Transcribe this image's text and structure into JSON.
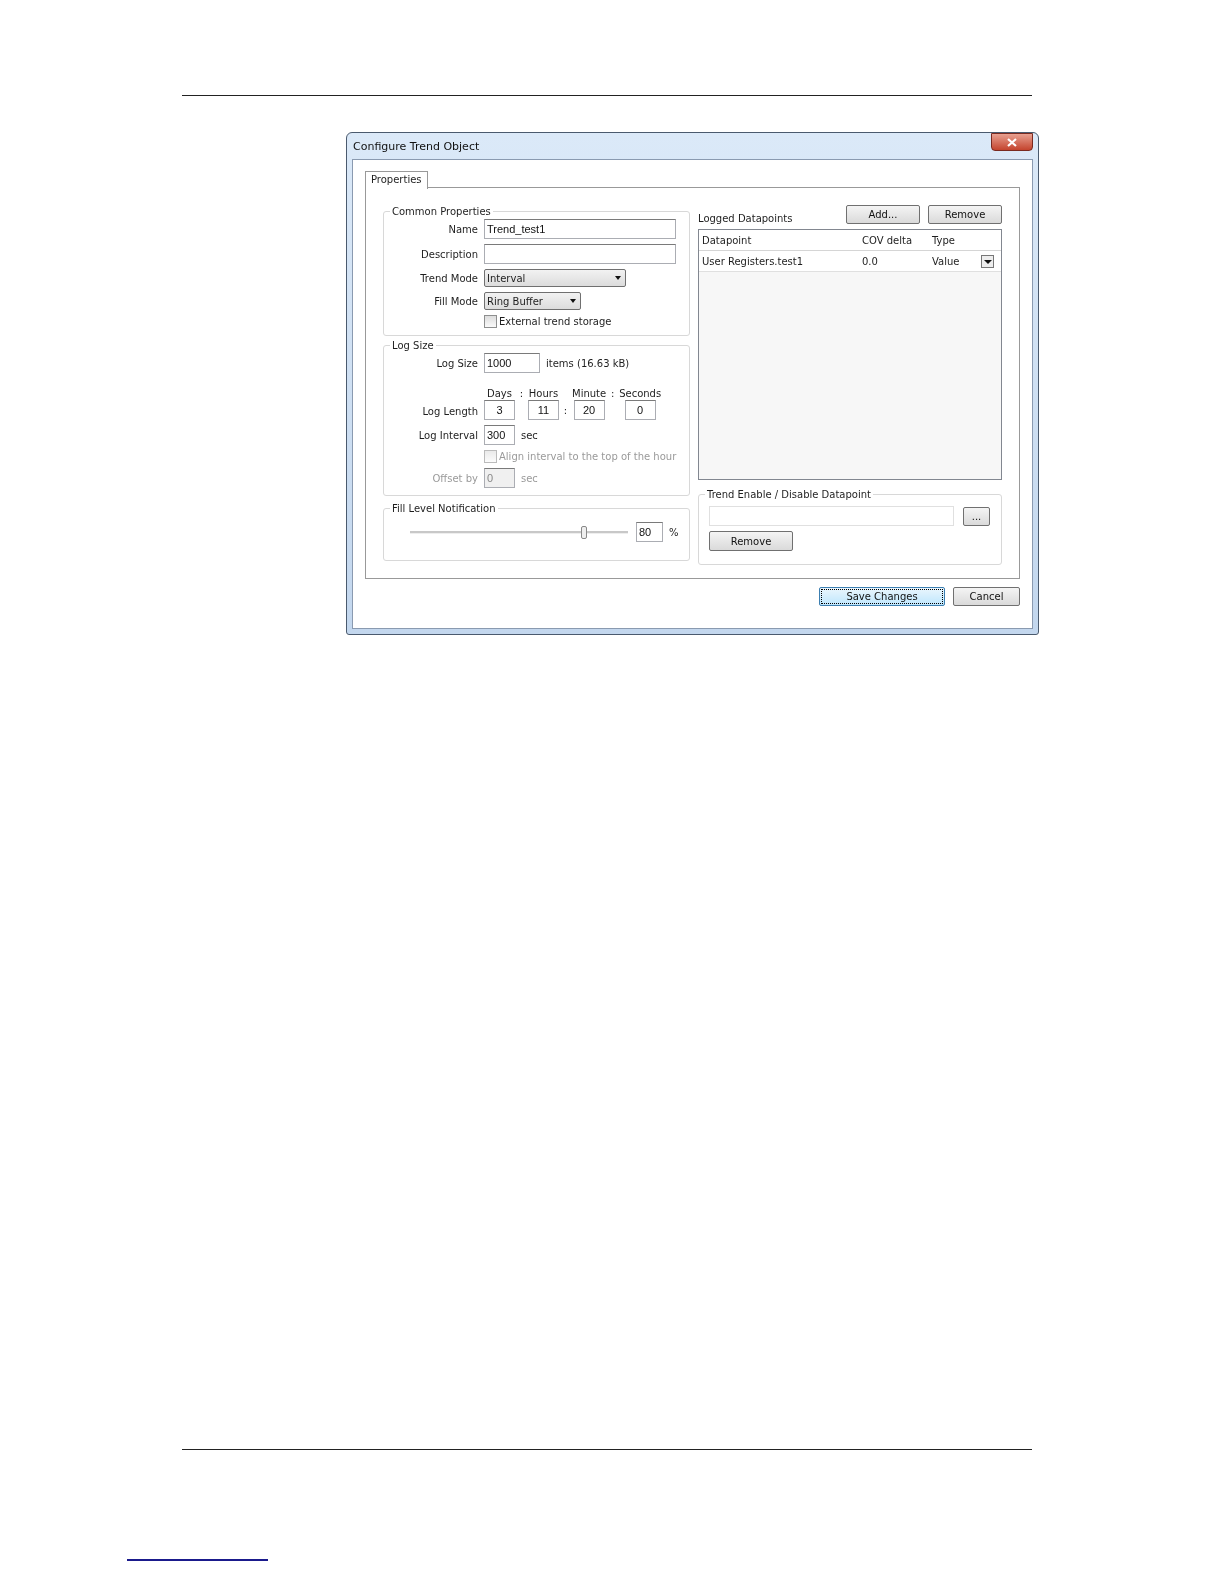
{
  "window": {
    "title": "Configure Trend Object"
  },
  "tabs": [
    {
      "label": "Properties",
      "selected": true
    }
  ],
  "common_properties": {
    "title": "Common Properties",
    "fields": [
      {
        "kind": "text",
        "label": "Name",
        "value": "Trend_test1"
      },
      {
        "kind": "text",
        "label": "Description"
      },
      {
        "kind": "dropdown",
        "label": "Trend Mode",
        "value": "Interval"
      },
      {
        "kind": "dropdown",
        "label": "Fill Mode",
        "value": "Ring Buffer"
      },
      {
        "kind": "checkbox",
        "label": "External trend storage",
        "checked": false
      }
    ]
  },
  "log_size": {
    "title": "Log Size",
    "size": {
      "label": "Log Size",
      "value": "1000",
      "unit": "items (16.63 kB)"
    },
    "length": {
      "label": "Log Length",
      "parts": [
        {
          "heading": "Days",
          "value": "3",
          "heading_sep": ":"
        },
        {
          "heading": "Hours",
          "value": "11",
          "value_sep": ":"
        },
        {
          "heading": "Minute",
          "value": "20",
          "heading_sep": ":"
        },
        {
          "heading": "Seconds",
          "value": "0"
        }
      ]
    },
    "interval": {
      "label": "Log Interval",
      "value": "300",
      "unit": "sec"
    },
    "align": {
      "label": "Align interval to the top of the hour",
      "checked": false,
      "disabled": true
    },
    "offset": {
      "label": "Offset by",
      "value": "0",
      "unit": "sec",
      "disabled": true
    }
  },
  "fill_level": {
    "title": "Fill Level Notification",
    "level": 0.8,
    "value": "80",
    "unit": "%"
  },
  "logged_datapoints": {
    "title": "Logged Datapoints",
    "buttons": [
      "Add...",
      "Remove"
    ],
    "columns": [
      "Datapoint",
      "COV delta",
      "Type"
    ],
    "rows": [
      [
        "User Registers.test1",
        "0.0",
        "Value"
      ]
    ]
  },
  "trend_enable": {
    "title": "Trend Enable / Disable Datapoint",
    "browse_button": "...",
    "remove_button": "Remove"
  },
  "footer_buttons": [
    {
      "label": "Save Changes",
      "focused": true
    },
    {
      "label": "Cancel",
      "focused": false
    }
  ]
}
